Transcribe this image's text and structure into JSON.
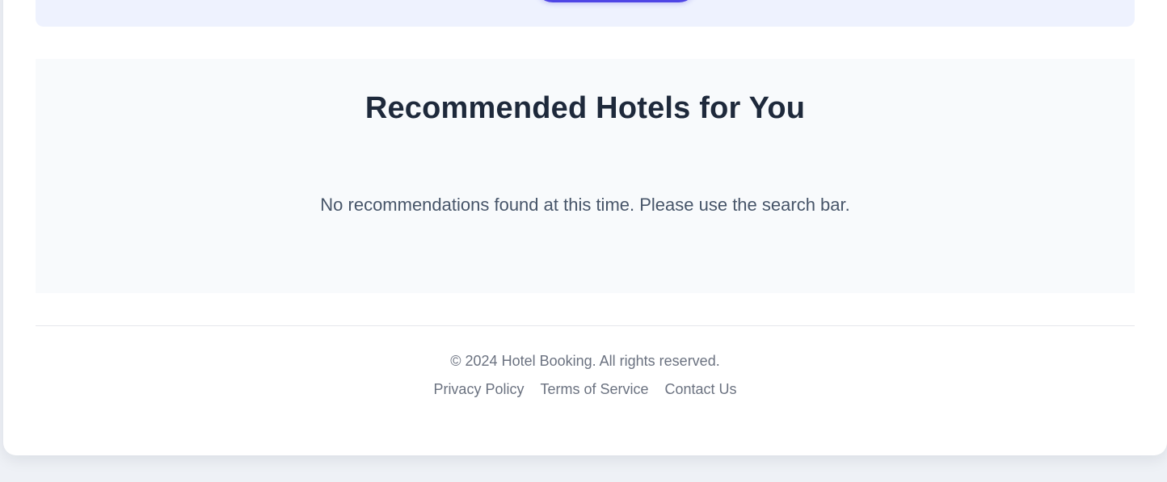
{
  "recommendations": {
    "title": "Recommended Hotels for You",
    "empty_message": "No recommendations found at this time. Please use the search bar."
  },
  "footer": {
    "copyright": "© 2024 Hotel Booking. All rights reserved.",
    "links": [
      {
        "label": "Privacy Policy"
      },
      {
        "label": "Terms of Service"
      },
      {
        "label": "Contact Us"
      }
    ]
  },
  "colors": {
    "accent": "#4f46e5",
    "page_background": "#eef1f6",
    "section_background": "#f8fafc",
    "heading": "#1e293b",
    "muted_text": "#6b7280"
  }
}
